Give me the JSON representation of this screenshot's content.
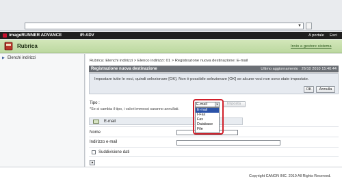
{
  "app": {
    "name": "imageRUNNER ADVANCE",
    "device": "iR-ADV",
    "portal_link": "Δ portale",
    "exit_link": "Esci"
  },
  "titlebar": {
    "title": "Rubrica",
    "admin_link": "Invio a gestore sistema"
  },
  "sidebar": {
    "items": [
      {
        "label": "Elenchi indirizzi"
      }
    ]
  },
  "main": {
    "breadcrumb": "Rubrica: Elenchi indirizzi > Elenco indirizzi: 01 > Registrazione nuova destinazione: E-mail",
    "panel": {
      "title": "Registrazione nuova destinazione",
      "last_update": "Ultimo aggiornamento : 26/10 2010 15:40:44"
    },
    "info": {
      "text": "Impostare tutte le voci, quindi selezionare [OK]. Non è possibile selezionare [OK] se alcune voci non sono state impostate.",
      "ok_label": "OK",
      "cancel_label": "Annulla"
    },
    "tipo": {
      "label": "Tipo :",
      "note": "*Se si cambia il tipo, i valori immessi saranno annullati.",
      "selected": "E-mail",
      "set_label": "Imposta",
      "options": [
        "E-mail",
        "I-Fax",
        "Fax",
        "Database",
        "File"
      ],
      "highlighted_option": "E-mail"
    },
    "section": {
      "title": "E-mail"
    },
    "fields": {
      "name_label": "Nome",
      "name_value": "",
      "email_label": "Indirizzo e-mail",
      "email_value": "",
      "split_label": "Suddivisione dati",
      "split_checked": false
    }
  },
  "footer": {
    "copyright": "Copyright CANON INC. 2010 All Rights Reserved."
  },
  "colors": {
    "titlebar": "#c6dfab",
    "appbar": "#1f1f1f",
    "panel_head": "#6b6f75",
    "highlight": "#d11f2a",
    "selected_option": "#2b52a8"
  }
}
